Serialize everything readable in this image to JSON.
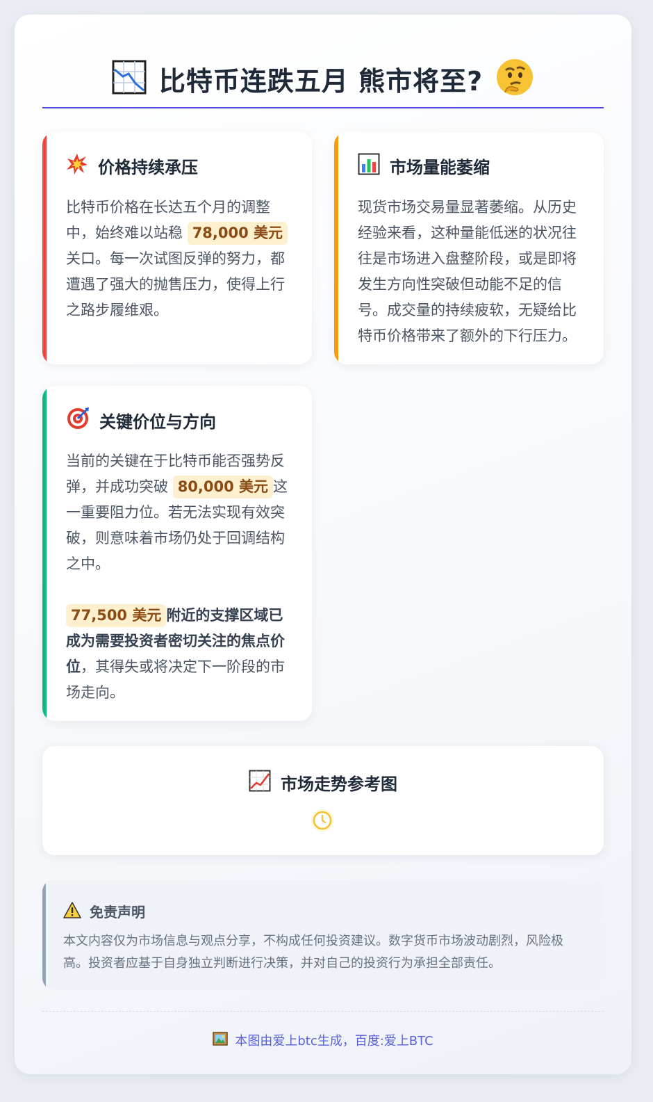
{
  "header": {
    "title": "比特币连跌五月 熊市将至?",
    "left_icon": "chart-decreasing-icon",
    "right_icon": "thinking-face-icon",
    "accent_color": "#4f46e5"
  },
  "cards": [
    {
      "icon": "collision-icon",
      "title": "价格持续承压",
      "accent_color": "#ef4444",
      "text_1": "比特币价格在长达五个月的调整中，始终难以站稳",
      "highlight": "78,000 美元",
      "text_2": "关口。每一次试图反弹的努力，都遭遇了强大的抛售压力，使得上行之路步履维艰。"
    },
    {
      "icon": "bar-chart-icon",
      "title": "市场量能萎缩",
      "accent_color": "#f59e0b",
      "text": "现货市场交易量显著萎缩。从历史经验来看，这种量能低迷的状况往往是市场进入盘整阶段，或是即将发生方向性突破但动能不足的信号。成交量的持续疲软，无疑给比特币价格带来了额外的下行压力。"
    },
    {
      "icon": "direct-hit-icon",
      "title": "关键价位与方向",
      "accent_color": "#10b981",
      "text_1": "当前的关键在于比特币能否强势反弹，并成功突破",
      "highlight_1": "80,000 美元",
      "text_2": "这一重要阻力位。若无法实现有效突破，则意味着市场仍处于回调结构之中。",
      "highlight_2": "77,500 美元",
      "bold_text": "附近的支撑区域已成为需要投资者密切关注的焦点价位",
      "text_3": "，其得失或将决定下一阶段的市场走向。"
    }
  ],
  "chart_section": {
    "icon": "chart-increasing-icon",
    "title": "市场走势参考图",
    "status_icon": "clock-icon"
  },
  "disclaimer": {
    "icon": "warning-icon",
    "title": "免责声明",
    "text": "本文内容仅为市场信息与观点分享，不构成任何投资建议。数字货币市场波动剧烈，风险极高。投资者应基于自身独立判断进行决策，并对自己的投资行为承担全部责任。"
  },
  "footer": {
    "icon": "picture-icon",
    "text": "本图由爱上btc生成，百度:爱上BTC"
  }
}
